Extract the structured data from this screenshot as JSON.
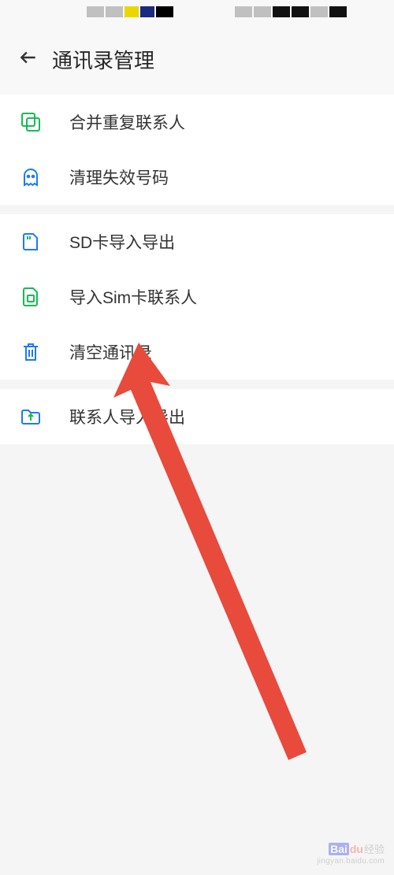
{
  "header": {
    "title": "通讯录管理"
  },
  "sections": [
    {
      "items": [
        {
          "key": "merge",
          "label": "合并重复联系人"
        },
        {
          "key": "cleanup",
          "label": "清理失效号码"
        }
      ]
    },
    {
      "items": [
        {
          "key": "sdcard",
          "label": "SD卡导入导出"
        },
        {
          "key": "sim",
          "label": "导入Sim卡联系人"
        },
        {
          "key": "clear",
          "label": "清空通讯录"
        }
      ]
    },
    {
      "items": [
        {
          "key": "importexport",
          "label": "联系人导入导出"
        }
      ]
    }
  ],
  "icons": {
    "merge": "merge-icon",
    "cleanup": "ghost-icon",
    "sdcard": "sdcard-icon",
    "sim": "simcard-icon",
    "clear": "trash-icon",
    "importexport": "folder-upload-icon"
  },
  "colors": {
    "green": "#19b955",
    "blue": "#1e7bf2",
    "red": "#e84a3c"
  },
  "watermark": {
    "brand1": "Bai",
    "brand2": "du",
    "brand3": "经验",
    "url": "jingyan.baidu.com"
  }
}
